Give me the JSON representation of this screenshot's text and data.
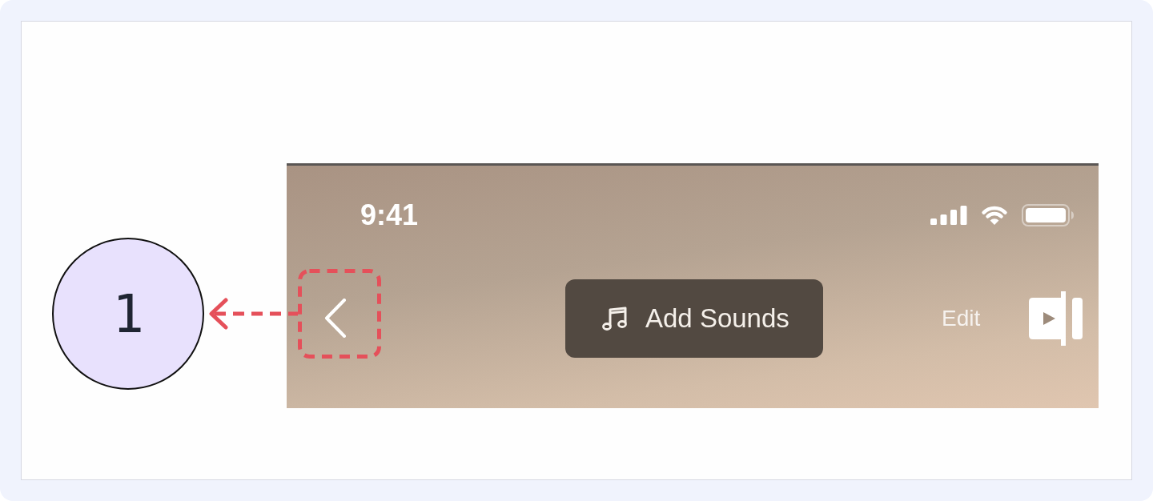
{
  "callout": {
    "number": "1"
  },
  "phone_screen": {
    "status_bar": {
      "time": "9:41"
    },
    "nav_bar": {
      "back_button": {
        "highlighted": true
      },
      "add_sounds_button": {
        "label": "Add Sounds"
      },
      "edit_button": {
        "label": "Edit"
      }
    }
  }
}
